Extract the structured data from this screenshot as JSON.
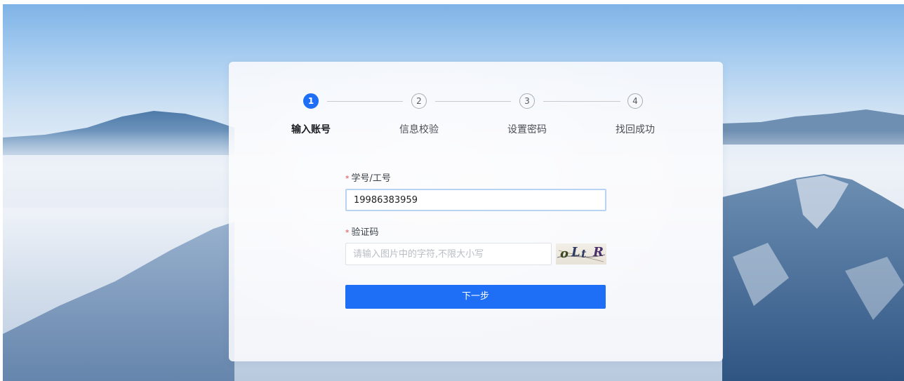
{
  "steps": [
    {
      "number": "1",
      "label": "输入账号",
      "state": "active"
    },
    {
      "number": "2",
      "label": "信息校验",
      "state": "inactive"
    },
    {
      "number": "3",
      "label": "设置密码",
      "state": "inactive"
    },
    {
      "number": "4",
      "label": "找回成功",
      "state": "inactive"
    }
  ],
  "form": {
    "account": {
      "required_mark": "*",
      "label": "学号/工号",
      "value": "19986383959"
    },
    "captcha": {
      "required_mark": "*",
      "label": "验证码",
      "value": "",
      "placeholder": "请输入图片中的字符,不限大小写",
      "image_text": [
        "o",
        "L",
        "t",
        "R"
      ]
    },
    "submit_label": "下一步"
  },
  "colors": {
    "primary": "#1e6ff5",
    "required": "#e0484b"
  }
}
